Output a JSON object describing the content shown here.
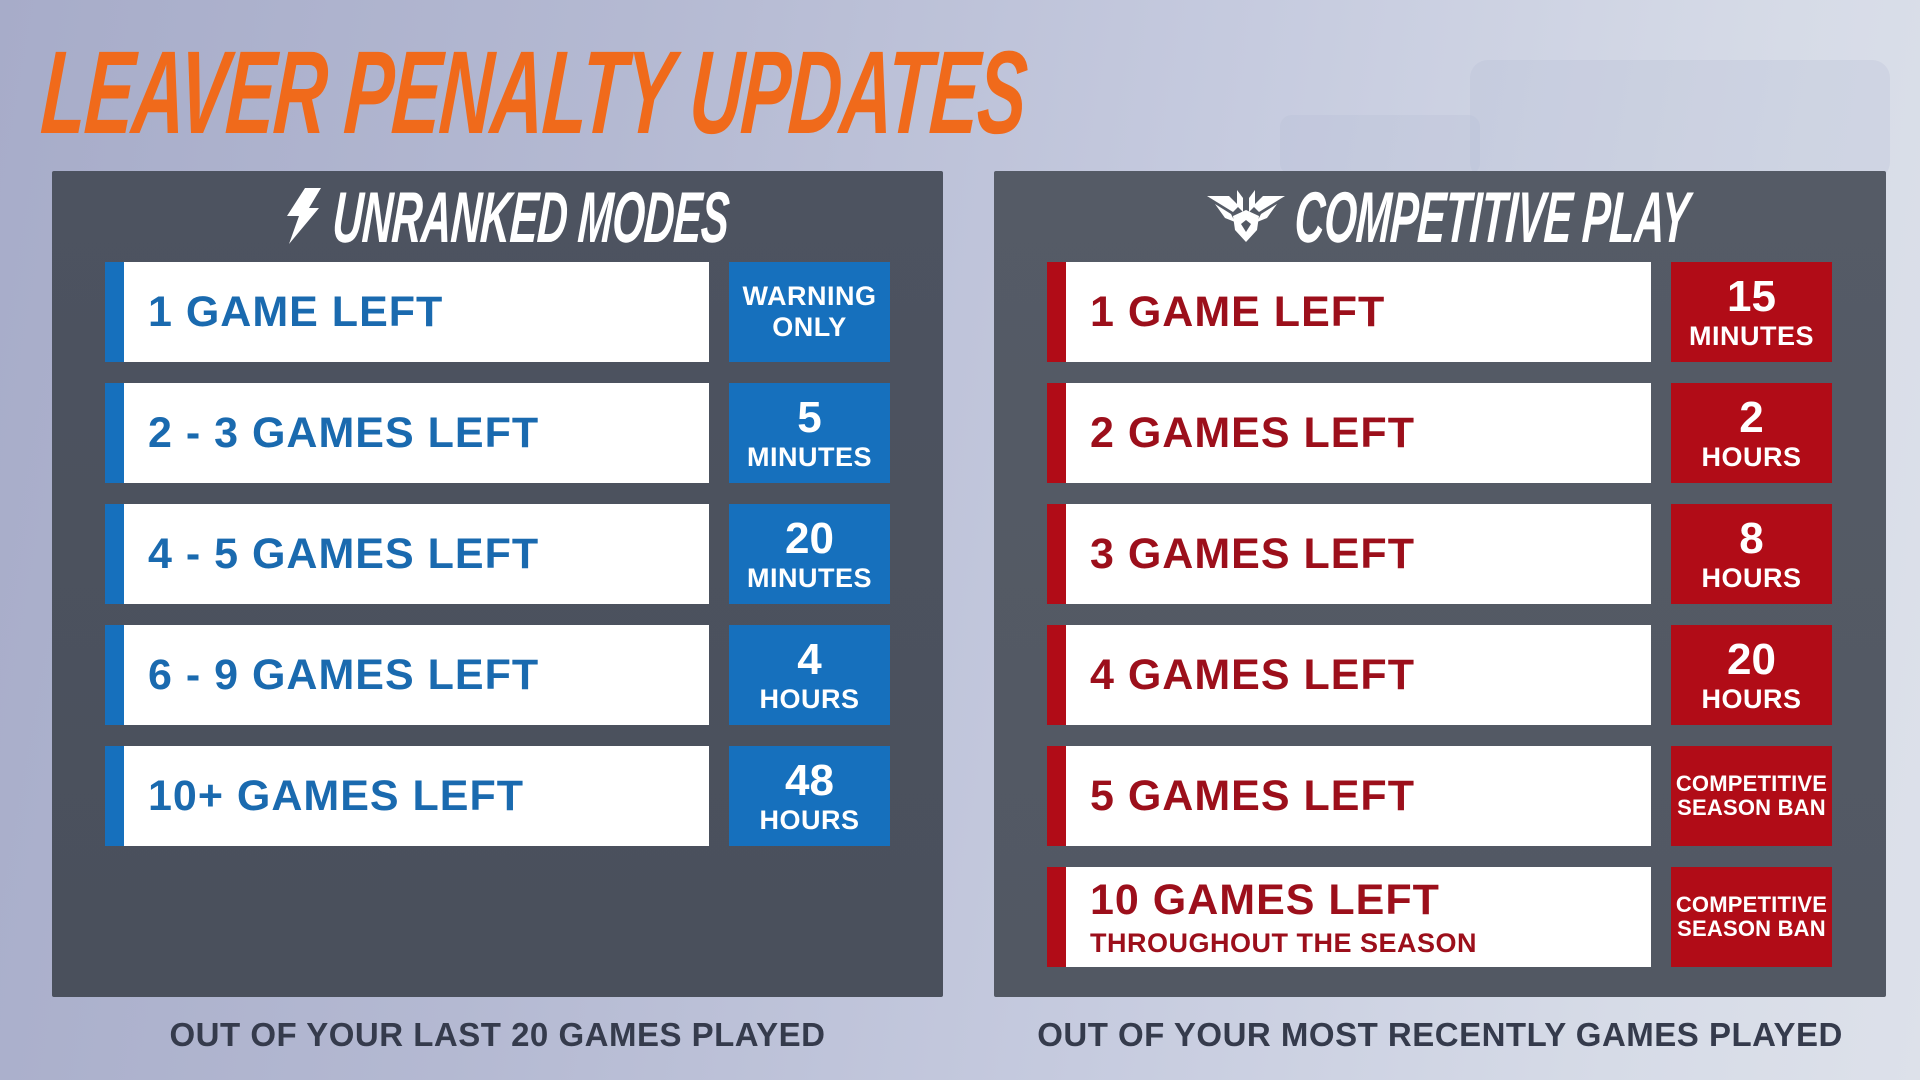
{
  "title": "LEAVER PENALTY UPDATES",
  "colors": {
    "title_orange": "#f06a1b",
    "unranked_blue": "#1670bd",
    "competitive_red": "#b10c17",
    "panel_gray": "#4b515c",
    "footer_text": "#353b4c"
  },
  "unranked": {
    "icon": "lightning-bolt-icon",
    "heading": "UNRANKED MODES",
    "rows": [
      {
        "label": "1 GAME LEFT",
        "penalty_line1": "WARNING",
        "penalty_line2": "ONLY"
      },
      {
        "label": "2 - 3 GAMES LEFT",
        "penalty_value": "5",
        "penalty_unit": "MINUTES"
      },
      {
        "label": "4 - 5 GAMES LEFT",
        "penalty_value": "20",
        "penalty_unit": "MINUTES"
      },
      {
        "label": "6 - 9 GAMES LEFT",
        "penalty_value": "4",
        "penalty_unit": "HOURS"
      },
      {
        "label": "10+ GAMES LEFT",
        "penalty_value": "48",
        "penalty_unit": "HOURS"
      }
    ],
    "footer": "OUT OF YOUR LAST 20 GAMES PLAYED"
  },
  "competitive": {
    "icon": "competitive-emblem-icon",
    "heading": "COMPETITIVE PLAY",
    "rows": [
      {
        "label": "1 GAME LEFT",
        "penalty_value": "15",
        "penalty_unit": "MINUTES"
      },
      {
        "label": "2 GAMES LEFT",
        "penalty_value": "2",
        "penalty_unit": "HOURS"
      },
      {
        "label": "3 GAMES LEFT",
        "penalty_value": "8",
        "penalty_unit": "HOURS"
      },
      {
        "label": "4 GAMES LEFT",
        "penalty_value": "20",
        "penalty_unit": "HOURS"
      },
      {
        "label": "5 GAMES LEFT",
        "penalty_line1": "COMPETITIVE",
        "penalty_line2": "SEASON BAN"
      },
      {
        "label": "10 GAMES LEFT",
        "sublabel": "THROUGHOUT THE SEASON",
        "penalty_line1": "COMPETITIVE",
        "penalty_line2": "SEASON BAN"
      }
    ],
    "footer": "OUT OF YOUR MOST RECENTLY GAMES PLAYED"
  }
}
